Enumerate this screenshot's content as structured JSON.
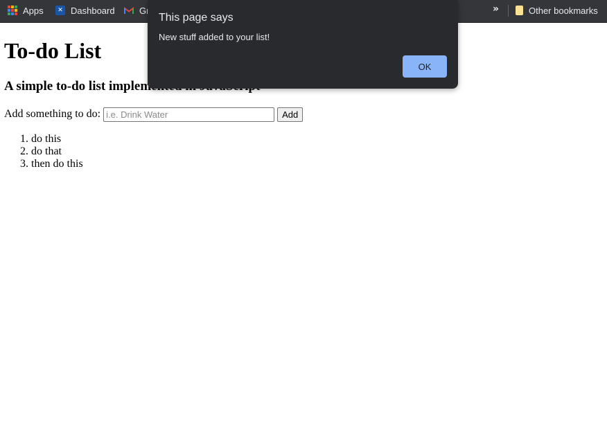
{
  "bookmarks_bar": {
    "items": [
      {
        "label": "Apps",
        "icon": "apps-grid-icon"
      },
      {
        "label": "Dashboard",
        "icon": "dashboard-icon"
      },
      {
        "label": "Gr",
        "icon": "gmail-icon"
      }
    ],
    "overflow_icon": "»",
    "other_bookmarks": {
      "label": "Other bookmarks",
      "icon": "folder-icon"
    }
  },
  "page": {
    "title": "To-do List",
    "subtitle": "A simple to-do list implemented in JavaScript",
    "form": {
      "label": "Add something to do:",
      "input_value": "",
      "input_placeholder": "i.e. Drink Water",
      "button_label": "Add"
    },
    "todos": [
      "do this",
      "do that",
      "then do this"
    ]
  },
  "alert": {
    "title": "This page says",
    "message": "New stuff added to your list!",
    "ok_label": "OK"
  },
  "colors": {
    "bookmarks_bar_bg": "#35363a",
    "dialog_bg": "#292a2d",
    "ok_button_bg": "#8ab4f8"
  }
}
